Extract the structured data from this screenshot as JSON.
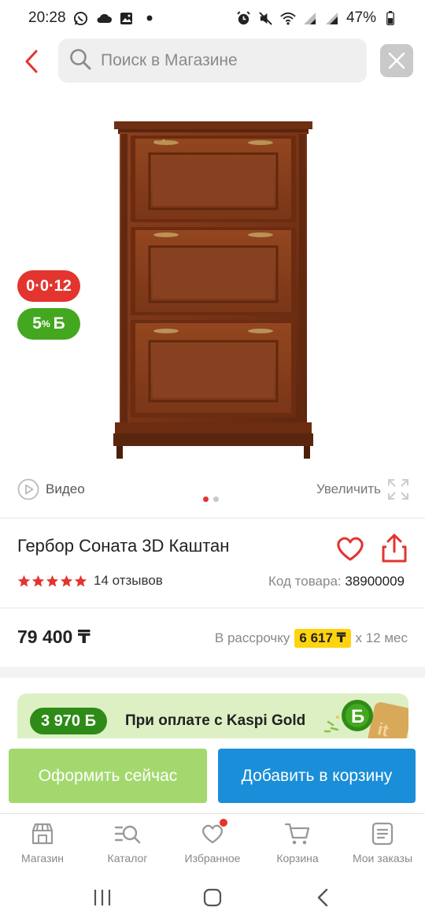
{
  "status_bar": {
    "time": "20:28",
    "battery": "47%"
  },
  "search": {
    "placeholder": "Поиск в Магазине"
  },
  "badges": {
    "timer": "0·0·12",
    "bonus_percent": "5",
    "bonus_percent_sign": "%",
    "bonus_currency": "Б"
  },
  "gallery": {
    "video_label": "Видео",
    "zoom_label": "Увеличить",
    "slide_count": 2,
    "active_slide": 1
  },
  "product": {
    "title": "Гербор Соната 3D Каштан",
    "rating": 5,
    "reviews": "14 отзывов",
    "sku_label": "Код товара:",
    "sku_value": "38900009",
    "price": "79 400 ₸",
    "installment_label": "В рассрочку",
    "installment_amount": "6 617 ₸",
    "installment_term": "x 12 мес"
  },
  "kaspi_gold": {
    "bonus": "3 970 Б",
    "text": "При оплате с Kaspi Gold"
  },
  "actions": {
    "buy_now": "Оформить сейчас",
    "add_to_cart": "Добавить в корзину"
  },
  "bottom_nav": {
    "items": [
      {
        "label": "Магазин",
        "icon": "shop-icon"
      },
      {
        "label": "Каталог",
        "icon": "catalog-search-icon"
      },
      {
        "label": "Избранное",
        "icon": "heart-icon"
      },
      {
        "label": "Корзина",
        "icon": "cart-icon"
      },
      {
        "label": "Мои заказы",
        "icon": "orders-icon"
      }
    ]
  },
  "colors": {
    "accent_red": "#e3342f",
    "bonus_green": "#43a81f",
    "cart_blue": "#1a8ed8",
    "buy_now_green": "#a3d86e",
    "installment_yellow": "#ffd30f"
  }
}
